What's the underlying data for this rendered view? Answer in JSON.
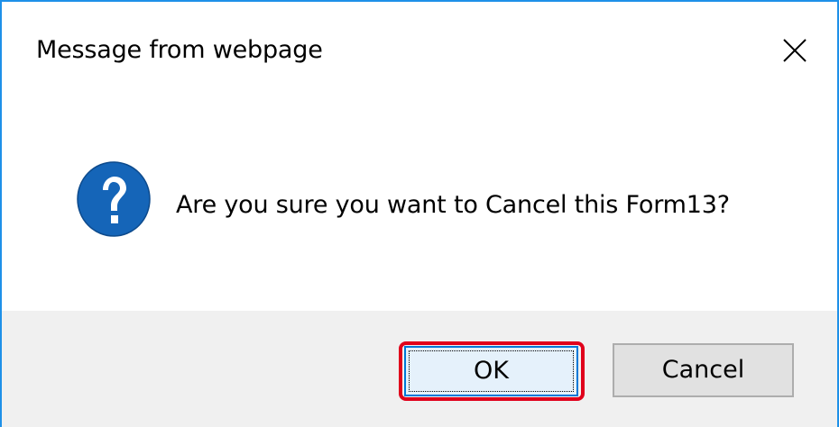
{
  "dialog": {
    "title": "Message from webpage",
    "message": "Are you sure you want to Cancel this Form13?",
    "icon": "question-icon",
    "buttons": {
      "ok_label": "OK",
      "cancel_label": "Cancel"
    },
    "colors": {
      "border": "#1e90e8",
      "icon_blue": "#1565b8",
      "footer_bg": "#f0f0f0",
      "highlight": "#e0001b",
      "ok_bg": "#e5f1fb"
    }
  }
}
